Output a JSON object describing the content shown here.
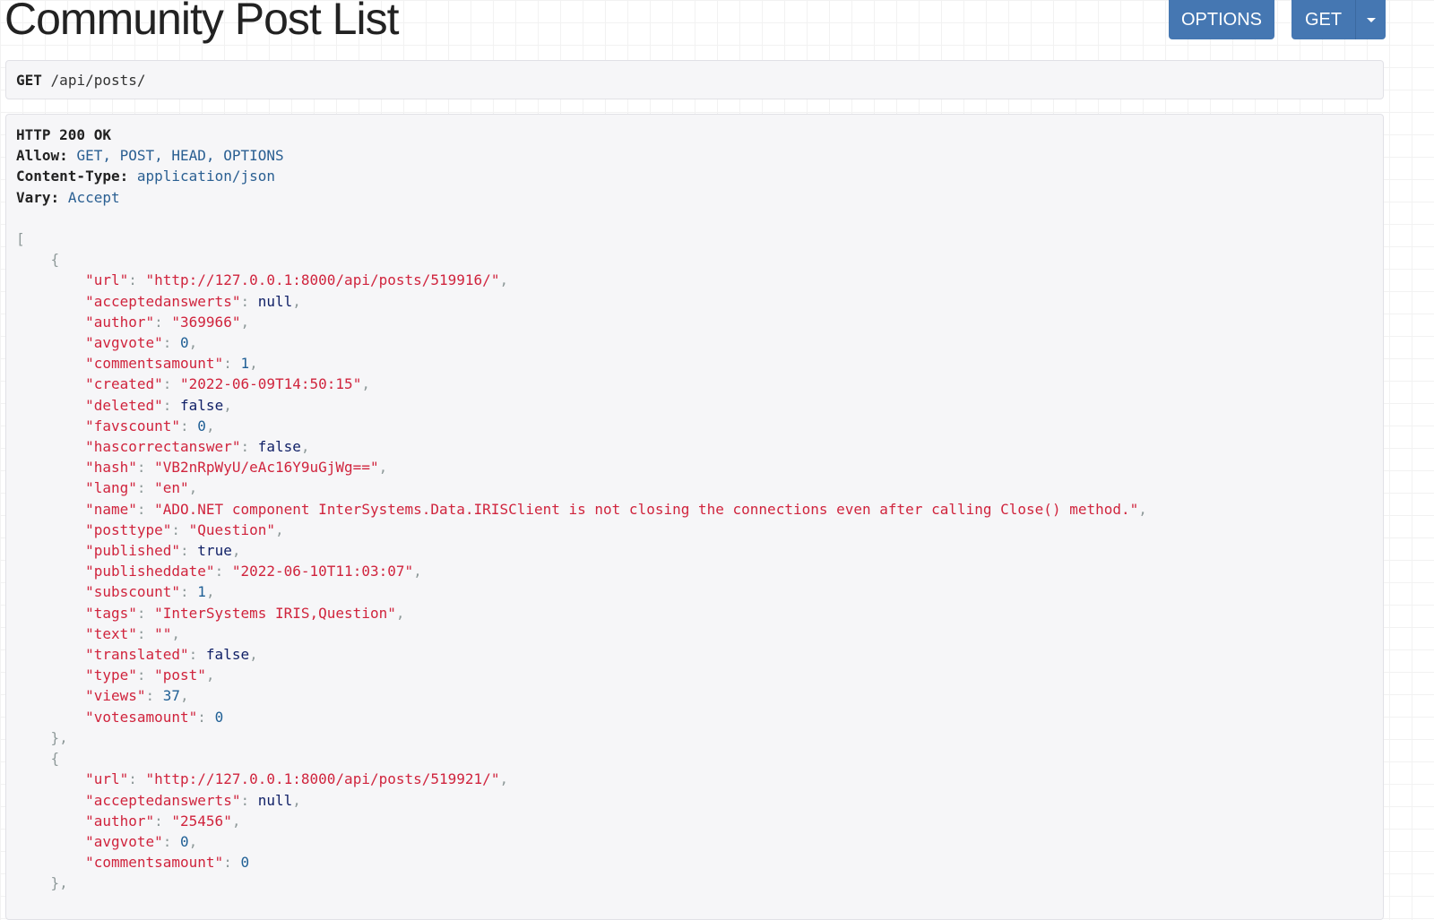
{
  "page": {
    "title": "Community Post List"
  },
  "buttons": {
    "options": "OPTIONS",
    "get": "GET"
  },
  "request": {
    "method": "GET",
    "path": "/api/posts/"
  },
  "response": {
    "status": "HTTP 200 OK",
    "headers": [
      {
        "name": "Allow:",
        "value": "GET, POST, HEAD, OPTIONS"
      },
      {
        "name": "Content-Type:",
        "value": "application/json"
      },
      {
        "name": "Vary:",
        "value": "Accept"
      }
    ],
    "posts": [
      [
        [
          "url",
          "http://127.0.0.1:8000/api/posts/519916/"
        ],
        [
          "acceptedanswerts",
          null
        ],
        [
          "author",
          "369966"
        ],
        [
          "avgvote",
          0
        ],
        [
          "commentsamount",
          1
        ],
        [
          "created",
          "2022-06-09T14:50:15"
        ],
        [
          "deleted",
          false
        ],
        [
          "favscount",
          0
        ],
        [
          "hascorrectanswer",
          false
        ],
        [
          "hash",
          "VB2nRpWyU/eAc16Y9uGjWg=="
        ],
        [
          "lang",
          "en"
        ],
        [
          "name",
          "ADO.NET component InterSystems.Data.IRISClient is not closing the connections even after calling Close() method."
        ],
        [
          "posttype",
          "Question"
        ],
        [
          "published",
          true
        ],
        [
          "publisheddate",
          "2022-06-10T11:03:07"
        ],
        [
          "subscount",
          1
        ],
        [
          "tags",
          "InterSystems IRIS,Question"
        ],
        [
          "text",
          ""
        ],
        [
          "translated",
          false
        ],
        [
          "type",
          "post"
        ],
        [
          "views",
          37
        ],
        [
          "votesamount",
          0
        ]
      ],
      [
        [
          "url",
          "http://127.0.0.1:8000/api/posts/519921/"
        ],
        [
          "acceptedanswerts",
          null
        ],
        [
          "author",
          "25456"
        ],
        [
          "avgvote",
          0
        ],
        [
          "commentsamount",
          0
        ]
      ]
    ]
  }
}
